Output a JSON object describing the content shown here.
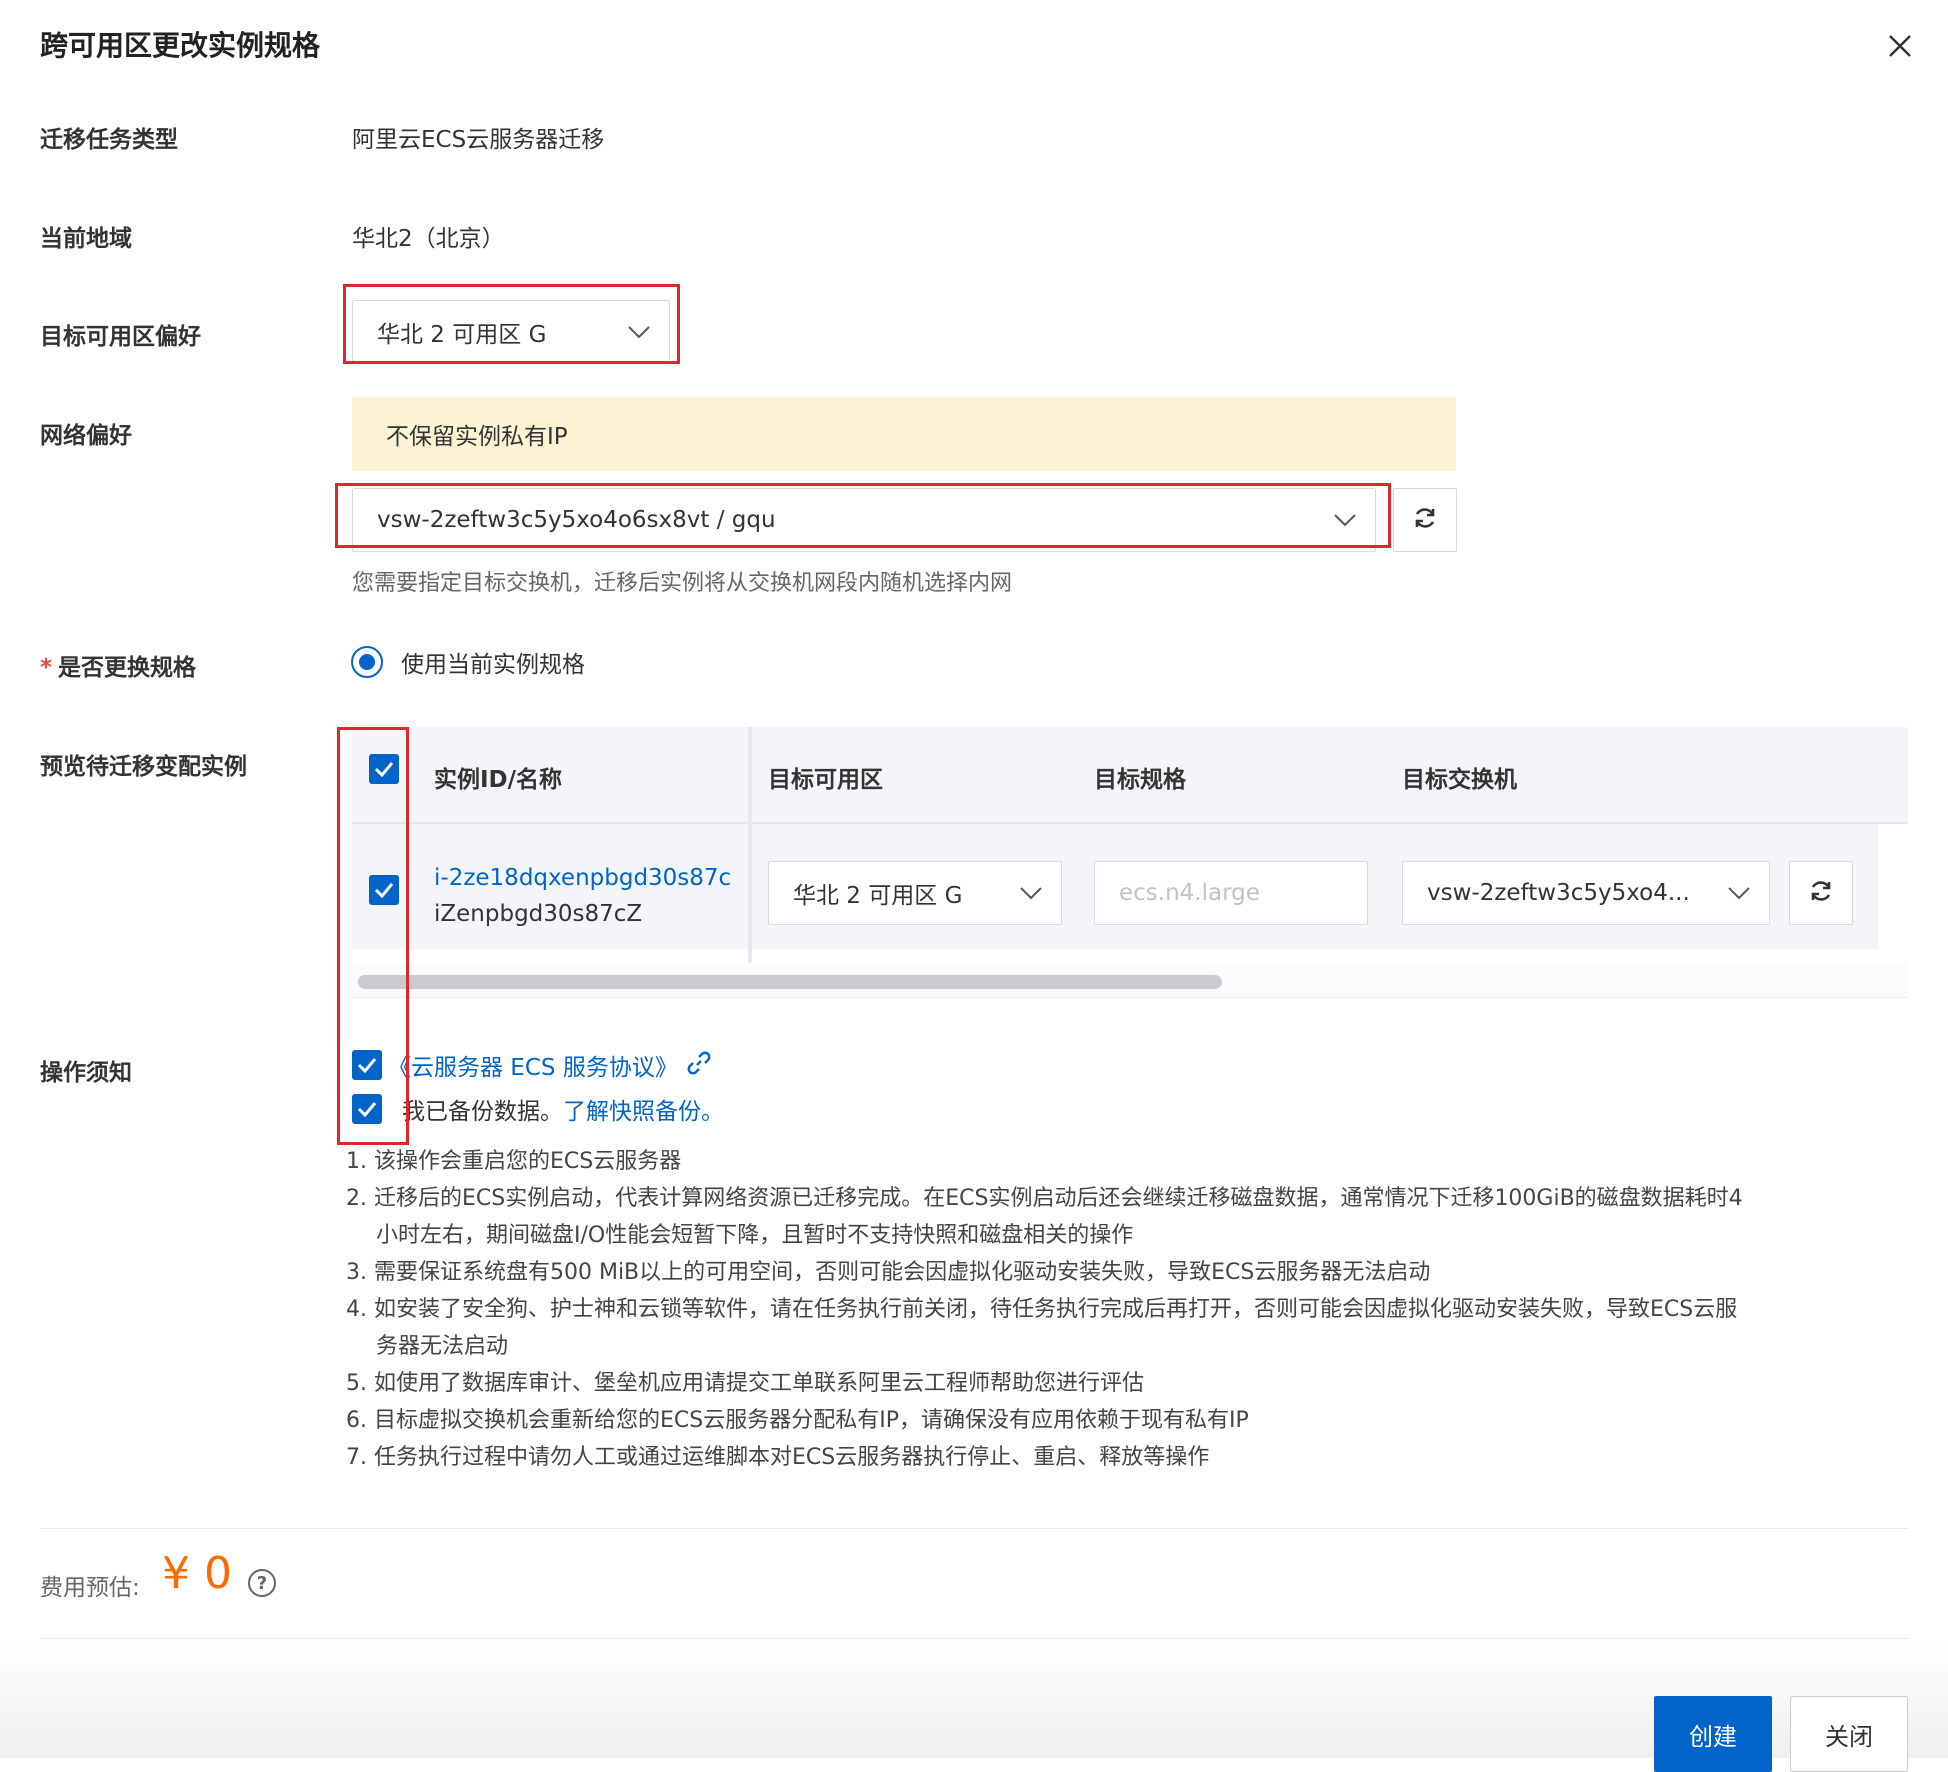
{
  "dialog": {
    "title": "跨可用区更改实例规格"
  },
  "form": {
    "task_type": {
      "label": "迁移任务类型",
      "value": "阿里云ECS云服务器迁移"
    },
    "region": {
      "label": "当前地域",
      "value": "华北2（北京）"
    },
    "target_zone": {
      "label": "目标可用区偏好",
      "selected": "华北 2 可用区 G"
    },
    "network": {
      "label": "网络偏好",
      "notice": "不保留实例私有IP",
      "vswitch_selected": "vsw-2zeftw3c5y5xo4o6sx8vt / gqu",
      "hint": "您需要指定目标交换机，迁移后实例将从交换机网段内随机选择内网"
    },
    "change_spec": {
      "required_mark": "*",
      "label": "是否更换规格",
      "option": "使用当前实例规格"
    },
    "preview": {
      "label": "预览待迁移变配实例",
      "columns": [
        "实例ID/名称",
        "目标可用区",
        "目标规格",
        "目标交换机"
      ],
      "rows": [
        {
          "instance_id": "i-2ze18dqxenpbgd30s87c",
          "instance_name": "iZenpbgd30s87cZ",
          "zone": "华北 2 可用区 G",
          "spec_placeholder": "ecs.n4.large",
          "vswitch": "vsw-2zeftw3c5y5xo4..."
        }
      ]
    },
    "notes": {
      "label": "操作须知",
      "agreement_link": "《云服务器 ECS 服务协议》",
      "backup_text": "我已备份数据。",
      "backup_link": "了解快照备份。",
      "items": [
        "1. 该操作会重启您的ECS云服务器",
        "2. 迁移后的ECS实例启动，代表计算网络资源已迁移完成。在ECS实例启动后还会继续迁移磁盘数据，通常情况下迁移100GiB的磁盘数据耗时4",
        "小时左右，期间磁盘I/O性能会短暂下降，且暂时不支持快照和磁盘相关的操作",
        "3. 需要保证系统盘有500 MiB以上的可用空间，否则可能会因虚拟化驱动安装失败，导致ECS云服务器无法启动",
        "4. 如安装了安全狗、护士神和云锁等软件，请在任务执行前关闭，待任务执行完成后再打开，否则可能会因虚拟化驱动安装失败，导致ECS云服",
        "务器无法启动",
        "5. 如使用了数据库审计、堡垒机应用请提交工单联系阿里云工程师帮助您进行评估",
        "6. 目标虚拟交换机会重新给您的ECS云服务器分配私有IP，请确保没有应用依赖于现有私有IP",
        "7. 任务执行过程中请勿人工或通过运维脚本对ECS云服务器执行停止、重启、释放等操作"
      ]
    }
  },
  "fee": {
    "label": "费用预估:",
    "value": "¥ 0",
    "help_glyph": "?"
  },
  "footer": {
    "create_label": "创建",
    "close_label": "关闭"
  },
  "colors": {
    "primary": "#0064c8",
    "highlight_box": "#e3262e",
    "fee": "#ff6a00",
    "notice_bg": "#fdf3d4"
  },
  "icons": [
    "close-icon",
    "chevron-down-icon",
    "refresh-icon",
    "check-icon",
    "link-icon",
    "help-icon"
  ]
}
